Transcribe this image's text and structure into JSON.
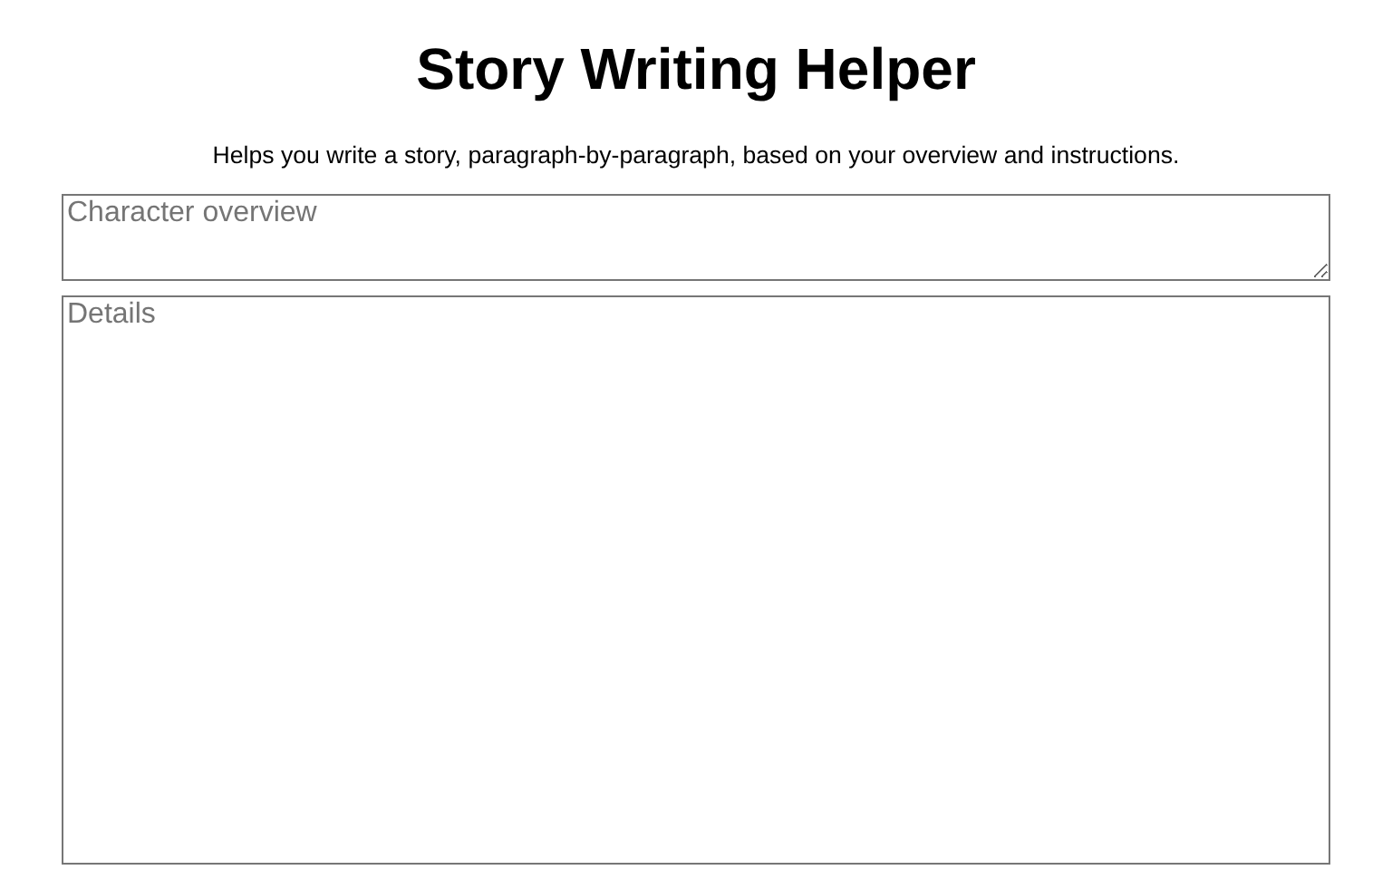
{
  "title": "Story Writing Helper",
  "description": "Helps you write a story, paragraph-by-paragraph, based on your overview and instructions.",
  "fields": [
    {
      "placeholder": "Character overview",
      "kind": "short"
    },
    {
      "placeholder": "Details",
      "kind": "tall"
    }
  ]
}
